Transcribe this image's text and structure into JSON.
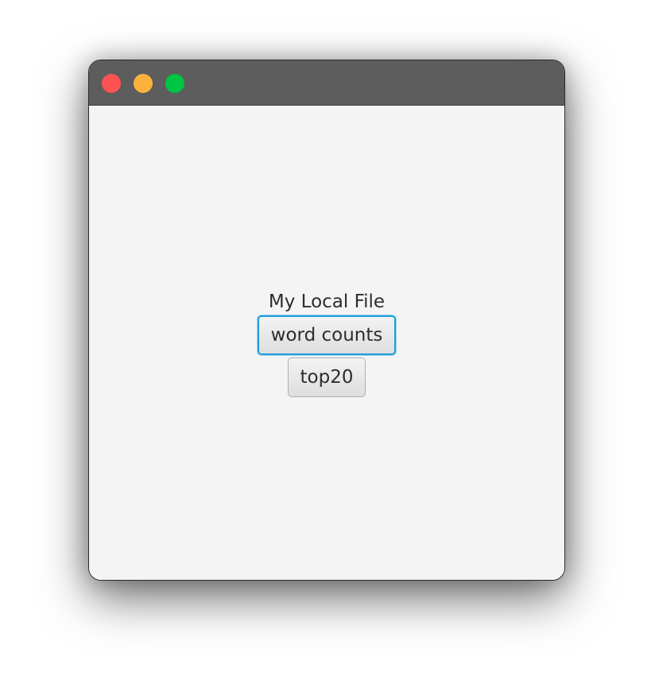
{
  "window": {
    "traffic_lights": [
      {
        "name": "close",
        "color": "#fe5252"
      },
      {
        "name": "minimize",
        "color": "#fdb13d"
      },
      {
        "name": "zoom",
        "color": "#00c443"
      }
    ],
    "titlebar_color": "#5c5d5c",
    "background_color": "#f4f4f4"
  },
  "main": {
    "label": "My Local File",
    "word_counts_button": "word counts",
    "top20_button": "top20",
    "focus_ring_color": "#1f9cd8"
  }
}
